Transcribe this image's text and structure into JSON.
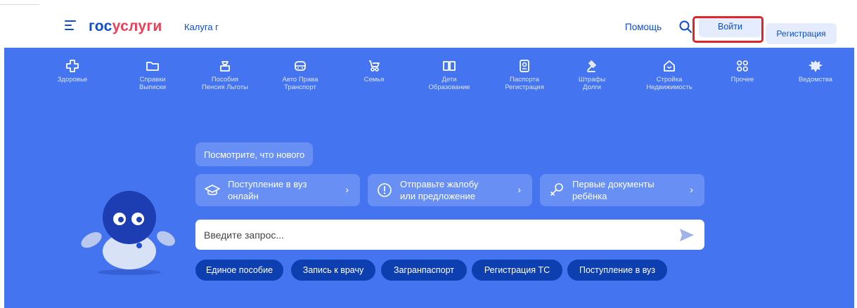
{
  "header": {
    "logo_part1": "гос",
    "logo_part2": "услуги",
    "region": "Калуга г",
    "help": "Помощь",
    "login": "Войти",
    "register": "Регистрация"
  },
  "categories": [
    {
      "label": "Здоровье",
      "icon": "health-icon"
    },
    {
      "label": "Справки\nВыписки",
      "icon": "folder-icon"
    },
    {
      "label": "Пособия\nПенсия Льготы",
      "icon": "wallet-icon"
    },
    {
      "label": "Авто Права\nТранспорт",
      "icon": "car-icon"
    },
    {
      "label": "Семья",
      "icon": "stroller-icon"
    },
    {
      "label": "Дети\nОбразование",
      "icon": "book-icon"
    },
    {
      "label": "Паспорта\nРегистрация",
      "icon": "passport-icon"
    },
    {
      "label": "Штрафы\nДолги",
      "icon": "gavel-icon"
    },
    {
      "label": "Стройка\nНедвижимость",
      "icon": "house-icon"
    },
    {
      "label": "Прочее",
      "icon": "grid-icon"
    },
    {
      "label": "Ведомства",
      "icon": "emblem-icon"
    }
  ],
  "news": "Посмотрите, что нового",
  "promos": [
    {
      "text": "Поступление в вуз\nонлайн",
      "icon": "graduation-cap-icon"
    },
    {
      "text": "Отправьте жалобу\nили предложение",
      "icon": "alert-icon"
    },
    {
      "text": "Первые документы\nребёнка",
      "icon": "rattle-icon"
    }
  ],
  "search": {
    "placeholder": "Введите запрос..."
  },
  "chips": [
    "Единое пособие",
    "Запись к врачу",
    "Загранпаспорт",
    "Регистрация ТС",
    "Поступление в вуз"
  ],
  "colors": {
    "brand_blue": "#0d4cd3",
    "brand_red": "#ee3f58",
    "hero_bg": "#4474f0",
    "chip_bg": "#0d3fb0",
    "highlight": "#e0252a"
  }
}
